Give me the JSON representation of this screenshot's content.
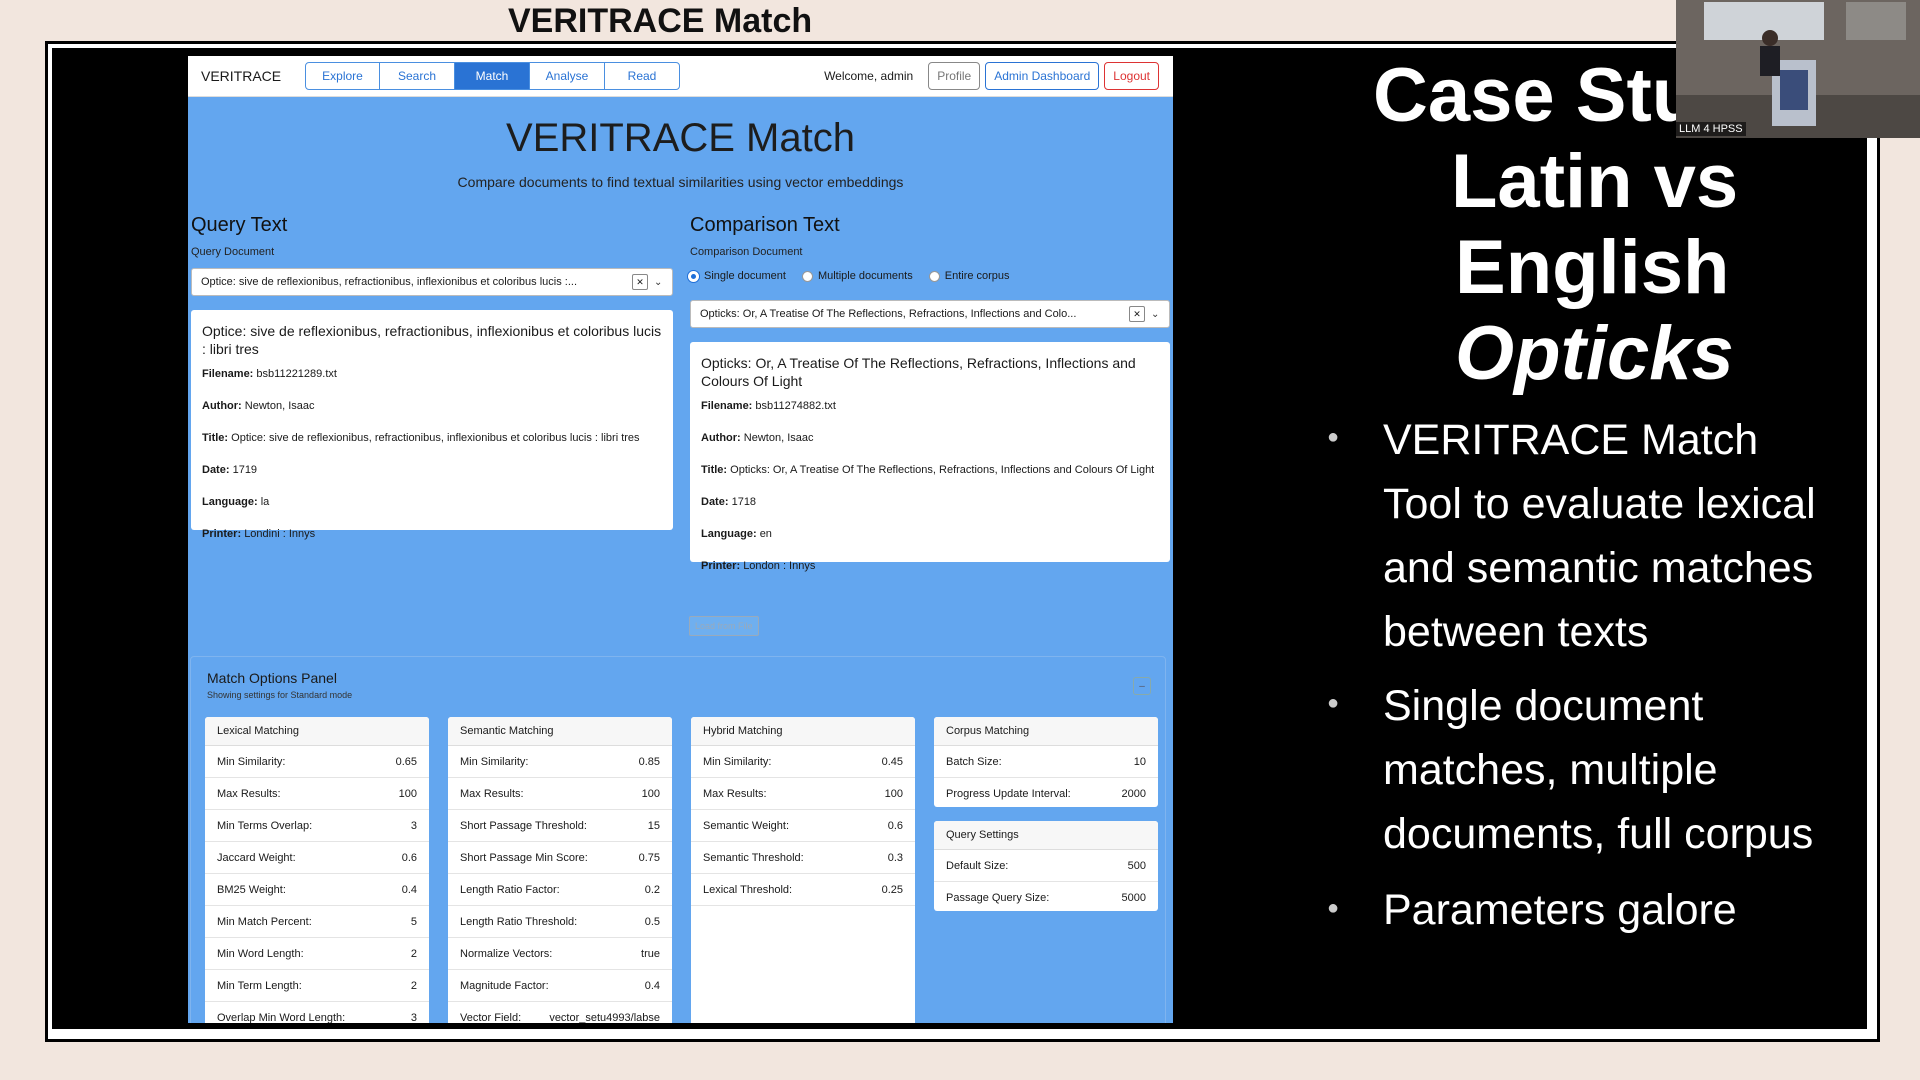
{
  "slide": {
    "title": "VERITRACE Match",
    "heading_lines": [
      "Case Stu",
      "Latin vs",
      "English",
      "Opticks"
    ],
    "bullets": [
      [
        "VERITRACE Match",
        "Tool to evaluate lexical",
        "and semantic matches",
        "between texts"
      ],
      [
        "Single document",
        "matches, multiple",
        "documents, full corpus"
      ],
      [
        "Parameters galore"
      ]
    ],
    "camera_label": "LLM 4 HPSS"
  },
  "app": {
    "brand": "VERITRACE",
    "tabs": [
      "Explore",
      "Search",
      "Match",
      "Analyse",
      "Read"
    ],
    "active_tab": "Match",
    "welcome": "Welcome, admin",
    "profile": "Profile",
    "admin_dashboard": "Admin Dashboard",
    "logout": "Logout",
    "title": "VERITRACE Match",
    "subtitle": "Compare documents to find textual similarities using vector embeddings",
    "query": {
      "heading": "Query Text",
      "label": "Query Document",
      "selected": "Optice: sive de reflexionibus, refractionibus, inflexionibus et coloribus lucis :...",
      "doc_title": "Optice: sive de reflexionibus, refractionibus, inflexionibus et coloribus lucis : libri tres",
      "filename_label": "Filename:",
      "filename": "bsb11221289.txt",
      "author_label": "Author:",
      "author": "Newton, Isaac",
      "title_label": "Title:",
      "title": "Optice: sive de reflexionibus, refractionibus, inflexionibus et coloribus lucis : libri tres",
      "date_label": "Date:",
      "date": "1719",
      "language_label": "Language:",
      "language": "la",
      "printer_label": "Printer:",
      "printer": "Londini : Innys"
    },
    "comparison": {
      "heading": "Comparison Text",
      "label": "Comparison Document",
      "radio_single": "Single document",
      "radio_multiple": "Multiple documents",
      "radio_corpus": "Entire corpus",
      "selected": "Opticks: Or, A Treatise Of The Reflections, Refractions, Inflections and Colo...",
      "doc_title": "Opticks: Or, A Treatise Of The Reflections, Refractions, Inflections and Colours Of Light",
      "filename_label": "Filename:",
      "filename": "bsb11274882.txt",
      "author_label": "Author:",
      "author": "Newton, Isaac",
      "title_label": "Title:",
      "title": "Opticks: Or, A Treatise Of The Reflections, Refractions, Inflections and Colours Of Light",
      "date_label": "Date:",
      "date": "1718",
      "language_label": "Language:",
      "language": "en",
      "printer_label": "Printer:",
      "printer": "London : Innys",
      "load_from_file": "Load from File"
    },
    "options": {
      "title": "Match Options Panel",
      "subtitle": "Showing settings for Standard mode",
      "lexical": {
        "heading": "Lexical Matching",
        "rows": [
          [
            "Min Similarity:",
            "0.65"
          ],
          [
            "Max Results:",
            "100"
          ],
          [
            "Min Terms Overlap:",
            "3"
          ],
          [
            "Jaccard Weight:",
            "0.6"
          ],
          [
            "BM25 Weight:",
            "0.4"
          ],
          [
            "Min Match Percent:",
            "5"
          ],
          [
            "Min Word Length:",
            "2"
          ],
          [
            "Min Term Length:",
            "2"
          ],
          [
            "Overlap Min Word Length:",
            "3"
          ]
        ]
      },
      "semantic": {
        "heading": "Semantic Matching",
        "rows": [
          [
            "Min Similarity:",
            "0.85"
          ],
          [
            "Max Results:",
            "100"
          ],
          [
            "Short Passage Threshold:",
            "15"
          ],
          [
            "Short Passage Min Score:",
            "0.75"
          ],
          [
            "Length Ratio Factor:",
            "0.2"
          ],
          [
            "Length Ratio Threshold:",
            "0.5"
          ],
          [
            "Normalize Vectors:",
            "true"
          ],
          [
            "Magnitude Factor:",
            "0.4"
          ],
          [
            "Vector Field:",
            "vector_setu4993/labse"
          ]
        ]
      },
      "hybrid": {
        "heading": "Hybrid Matching",
        "rows": [
          [
            "Min Similarity:",
            "0.45"
          ],
          [
            "Max Results:",
            "100"
          ],
          [
            "Semantic Weight:",
            "0.6"
          ],
          [
            "Semantic Threshold:",
            "0.3"
          ],
          [
            "Lexical Threshold:",
            "0.25"
          ]
        ]
      },
      "corpus": {
        "heading": "Corpus Matching",
        "rows": [
          [
            "Batch Size:",
            "10"
          ],
          [
            "Progress Update Interval:",
            "2000"
          ]
        ]
      },
      "query_settings": {
        "heading": "Query Settings",
        "rows": [
          [
            "Default Size:",
            "500"
          ],
          [
            "Passage Query Size:",
            "5000"
          ]
        ]
      }
    }
  }
}
